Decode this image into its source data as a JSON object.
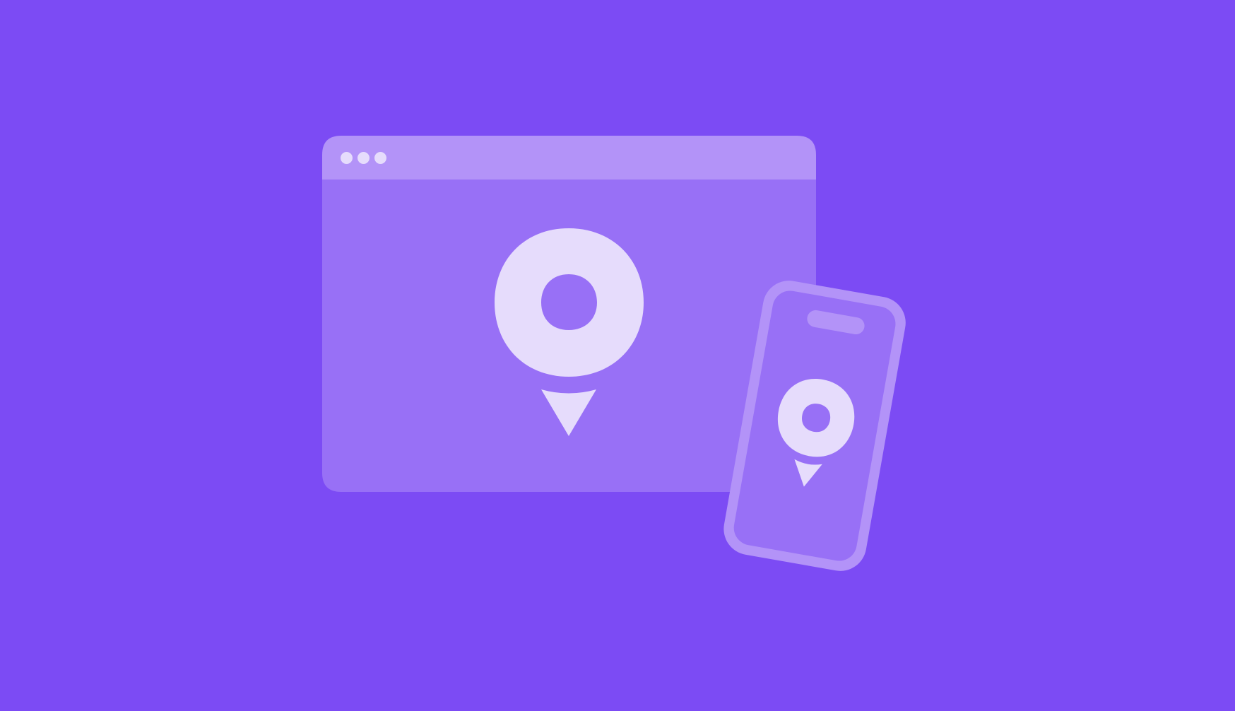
{
  "colors": {
    "background": "#7c4bf4",
    "window_body": "#9870f6",
    "window_titlebar": "#b393f8",
    "window_dot": "#e6dcfc",
    "logo_fill": "#e6dcfc",
    "phone_screen": "#9870f6",
    "phone_frame": "#b393f8",
    "phone_notch": "#b393f8"
  },
  "icons": {
    "window_controls": [
      "window-dot-icon",
      "window-dot-icon",
      "window-dot-icon"
    ],
    "browser_logo": "location-pin-logo-icon",
    "phone_logo": "location-pin-logo-icon"
  }
}
